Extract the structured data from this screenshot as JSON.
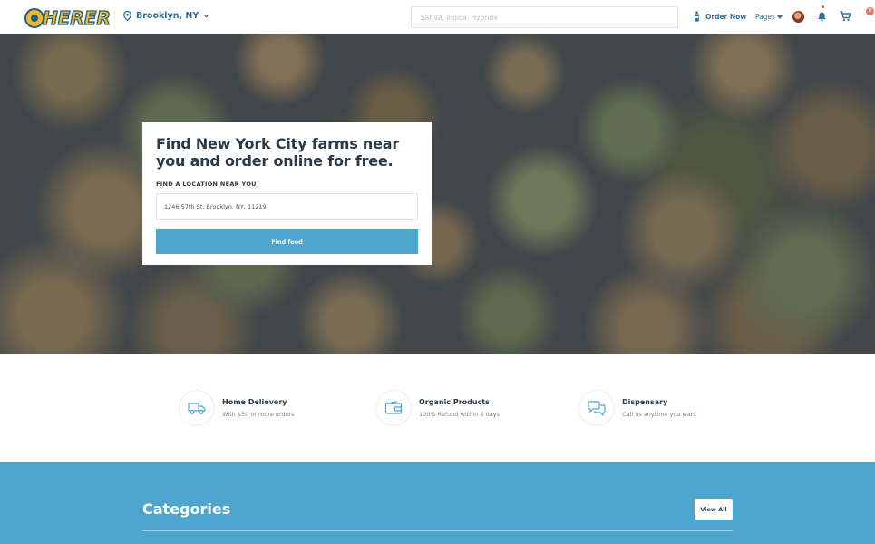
{
  "brand": {
    "logo_text": "HERER"
  },
  "header": {
    "location": "Brooklyn, NY",
    "search_placeholder": "Sativa, Indica, Hybride",
    "order_label": "Order Now",
    "pages_label": "Pages",
    "cart_count": "0"
  },
  "hero": {
    "title": "Find New York City farms near you and order online for free.",
    "location_label": "FIND A LOCATION NEAR YOU",
    "address_value": "1246 57th St, Brooklyn, NY, 11219",
    "find_button": "Find food"
  },
  "features": [
    {
      "title": "Home Delievery",
      "subtitle": "With $50 or more orders",
      "icon": "delivery-truck-icon"
    },
    {
      "title": "Organic Products",
      "subtitle": "100% Refund within 3 days",
      "icon": "wallet-icon"
    },
    {
      "title": "Dispensary",
      "subtitle": "Call us anytime you want",
      "icon": "chat-icon"
    }
  ],
  "categories": {
    "title": "Categories",
    "view_all": "View All"
  },
  "colors": {
    "accent": "#4ea6cf",
    "brand_blue": "#2f6f98",
    "logo_yellow": "#f3b823"
  }
}
